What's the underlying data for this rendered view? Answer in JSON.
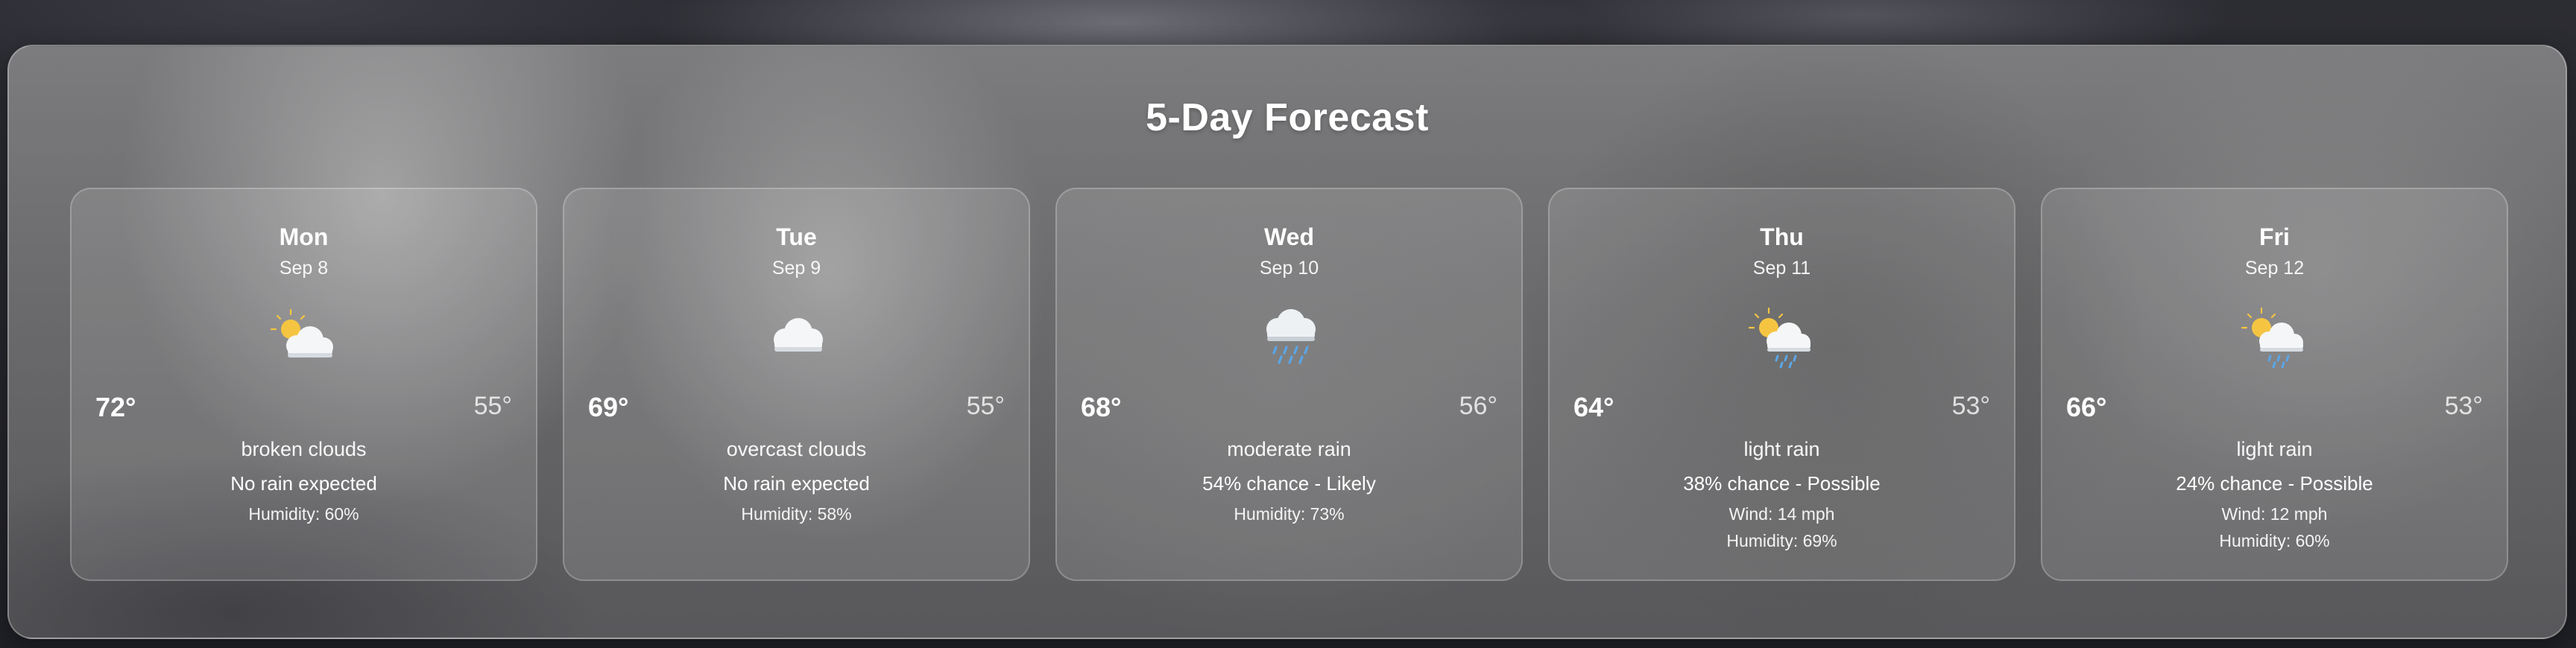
{
  "forecast": {
    "title": "5-Day Forecast",
    "days": [
      {
        "day": "Mon",
        "date": "Sep 8",
        "icon": "partly-cloudy-icon",
        "high": "72°",
        "low": "55°",
        "description": "broken clouds",
        "rain": "No rain expected",
        "wind": "",
        "humidity": "Humidity: 60%"
      },
      {
        "day": "Tue",
        "date": "Sep 9",
        "icon": "cloud-icon",
        "high": "69°",
        "low": "55°",
        "description": "overcast clouds",
        "rain": "No rain expected",
        "wind": "",
        "humidity": "Humidity: 58%"
      },
      {
        "day": "Wed",
        "date": "Sep 10",
        "icon": "rain-cloud-icon",
        "high": "68°",
        "low": "56°",
        "description": "moderate rain",
        "rain": "54% chance - Likely",
        "wind": "",
        "humidity": "Humidity: 73%"
      },
      {
        "day": "Thu",
        "date": "Sep 11",
        "icon": "sun-rain-icon",
        "high": "64°",
        "low": "53°",
        "description": "light rain",
        "rain": "38% chance - Possible",
        "wind": "Wind: 14 mph",
        "humidity": "Humidity: 69%"
      },
      {
        "day": "Fri",
        "date": "Sep 12",
        "icon": "sun-rain-icon",
        "high": "66°",
        "low": "53°",
        "description": "light rain",
        "rain": "24% chance - Possible",
        "wind": "Wind: 12 mph",
        "humidity": "Humidity: 60%"
      }
    ]
  },
  "colors": {
    "text": "#ffffff",
    "sun": "#f5c542",
    "rain": "#5aa6e8"
  }
}
